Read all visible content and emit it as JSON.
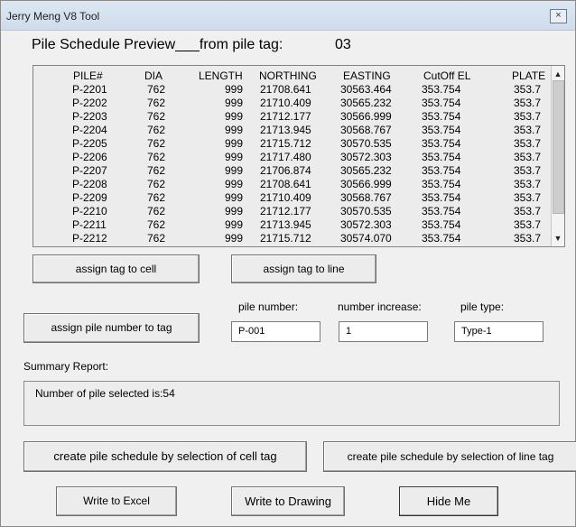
{
  "window": {
    "title": "Jerry Meng V8 Tool",
    "close_glyph": "×"
  },
  "heading": {
    "label": "Pile Schedule Preview___from pile tag:",
    "tag": "03"
  },
  "grid": {
    "columns": [
      "PILE#",
      "DIA",
      "LENGTH",
      "NORTHING",
      "EASTING",
      "CutOff EL",
      "PLATE"
    ],
    "rows": [
      [
        "P-2201",
        "762",
        "999",
        "21708.641",
        "30563.464",
        "353.754",
        "353.7"
      ],
      [
        "P-2202",
        "762",
        "999",
        "21710.409",
        "30565.232",
        "353.754",
        "353.7"
      ],
      [
        "P-2203",
        "762",
        "999",
        "21712.177",
        "30566.999",
        "353.754",
        "353.7"
      ],
      [
        "P-2204",
        "762",
        "999",
        "21713.945",
        "30568.767",
        "353.754",
        "353.7"
      ],
      [
        "P-2205",
        "762",
        "999",
        "21715.712",
        "30570.535",
        "353.754",
        "353.7"
      ],
      [
        "P-2206",
        "762",
        "999",
        "21717.480",
        "30572.303",
        "353.754",
        "353.7"
      ],
      [
        "P-2207",
        "762",
        "999",
        "21706.874",
        "30565.232",
        "353.754",
        "353.7"
      ],
      [
        "P-2208",
        "762",
        "999",
        "21708.641",
        "30566.999",
        "353.754",
        "353.7"
      ],
      [
        "P-2209",
        "762",
        "999",
        "21710.409",
        "30568.767",
        "353.754",
        "353.7"
      ],
      [
        "P-2210",
        "762",
        "999",
        "21712.177",
        "30570.535",
        "353.754",
        "353.7"
      ],
      [
        "P-2211",
        "762",
        "999",
        "21713.945",
        "30572.303",
        "353.754",
        "353.7"
      ],
      [
        "P-2212",
        "762",
        "999",
        "21715.712",
        "30574.070",
        "353.754",
        "353.7"
      ]
    ],
    "scroll_up": "▲",
    "scroll_down": "▼"
  },
  "buttons": {
    "assign_tag_to_cell": "assign tag to cell",
    "assign_tag_to_line": "assign tag to line",
    "assign_pile_number": "assign pile number to tag",
    "create_by_cell_tag": "create pile schedule by selection of cell tag",
    "create_by_line_tag": "create pile schedule by selection of line tag",
    "write_to_excel": "Write to Excel",
    "write_to_drawing": "Write to Drawing",
    "hide_me": "Hide Me"
  },
  "fields": {
    "pile_number_label": "pile number:",
    "pile_number_value": "P-001",
    "number_increase_label": "number increase:",
    "number_increase_value": "1",
    "pile_type_label": "pile type:",
    "pile_type_value": "Type-1"
  },
  "summary": {
    "label": "Summary Report:",
    "text": "Number of pile selected is:54"
  }
}
